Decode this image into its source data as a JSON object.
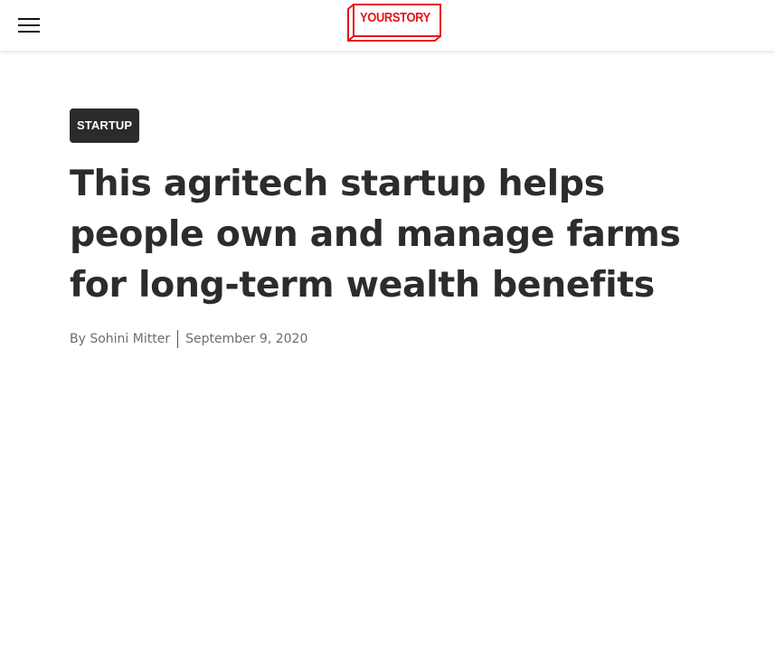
{
  "header": {
    "menu_icon": "hamburger-menu-icon",
    "logo_text": "YOURSTORY",
    "brand_color": "#e8141b"
  },
  "article": {
    "category": "STARTUP",
    "title": "This agritech startup helps people own and manage farms for long-term wealth benefits",
    "byline_prefix": "By",
    "author": "Sohini Mitter",
    "date": "September 9, 2020"
  }
}
